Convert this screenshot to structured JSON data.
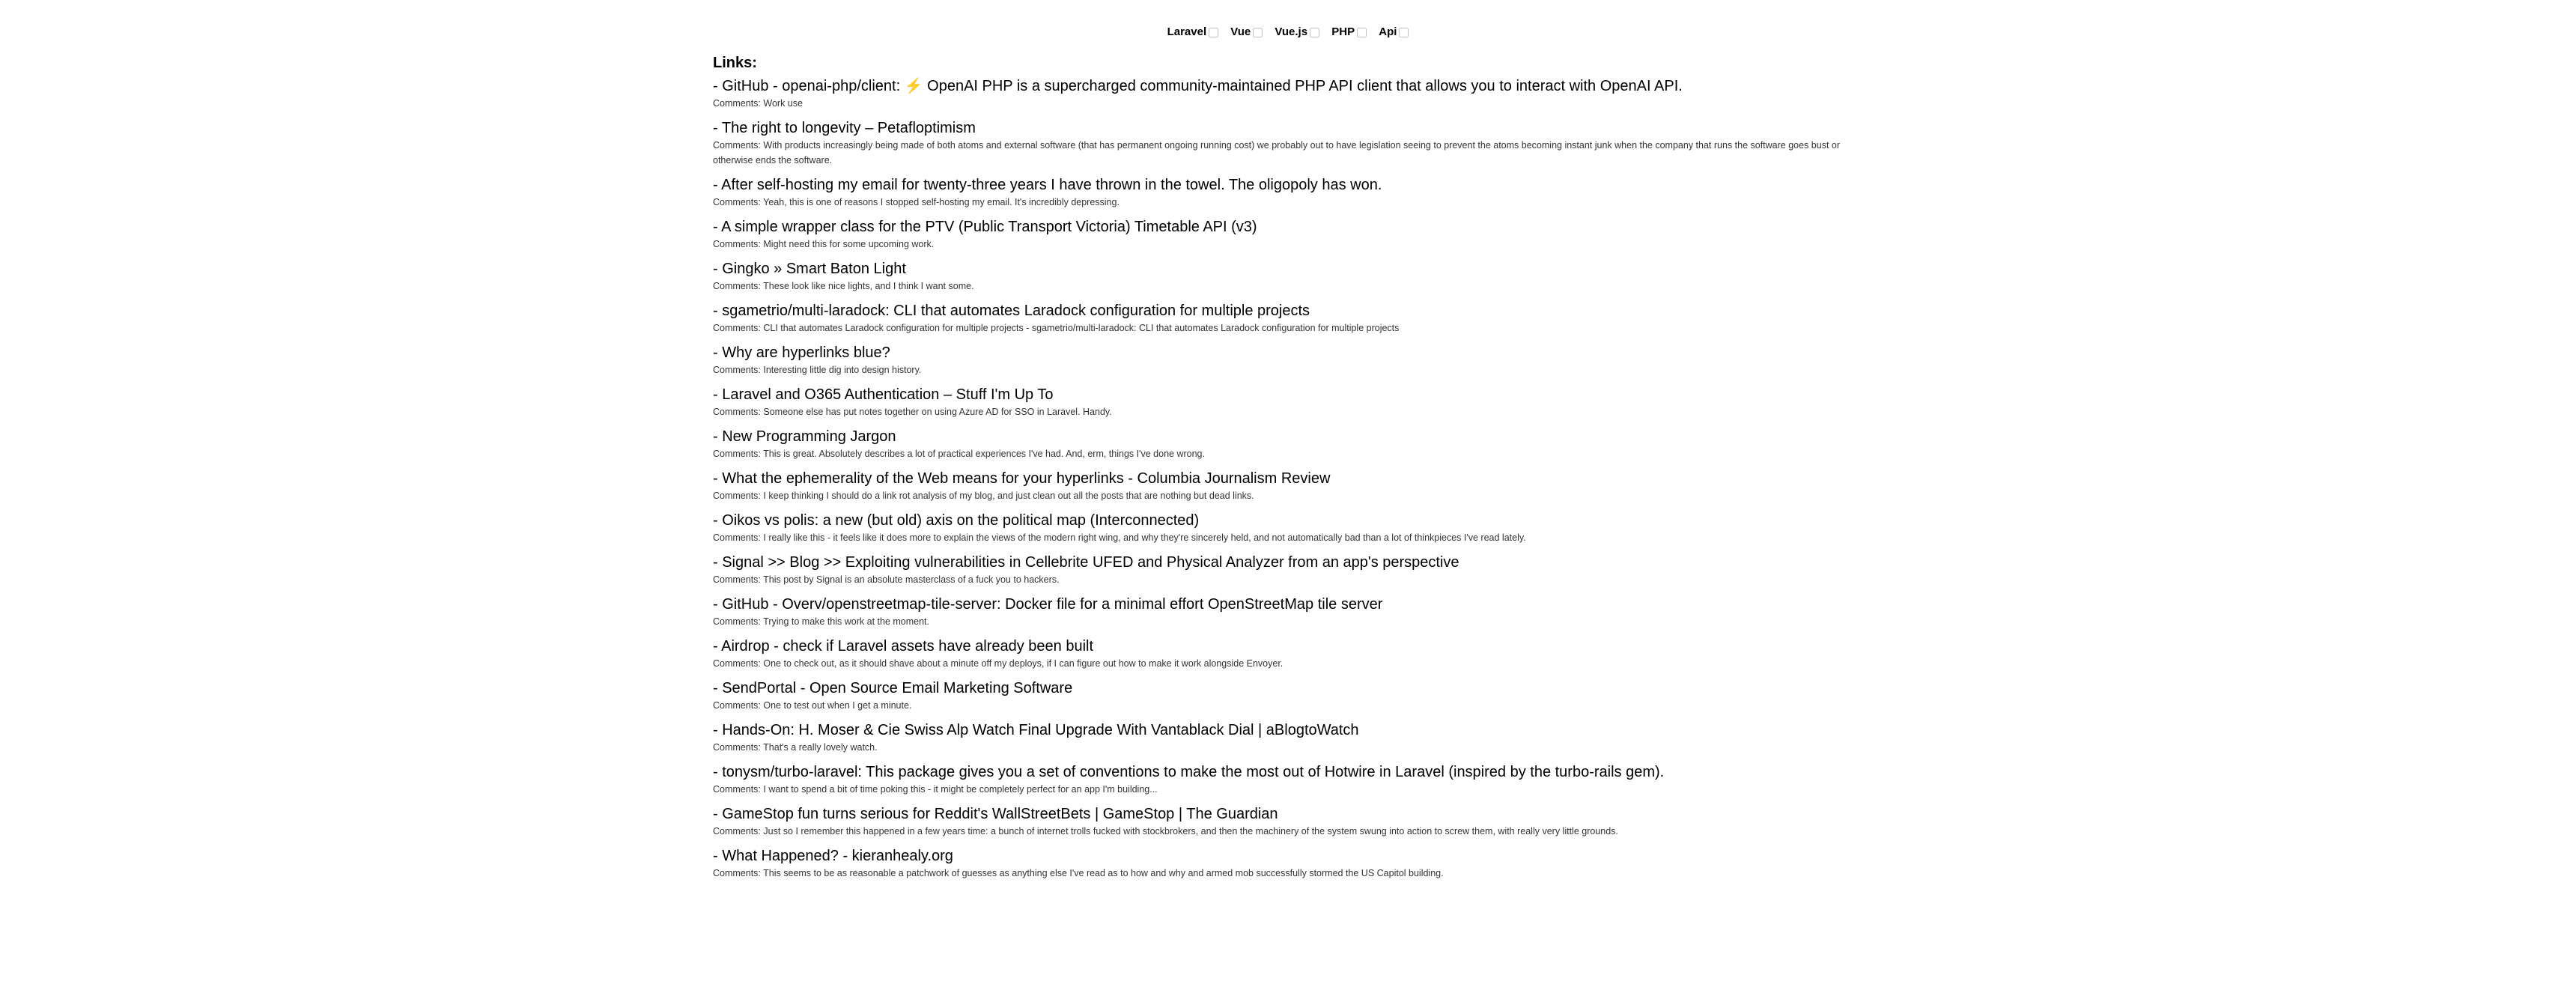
{
  "filters": [
    {
      "label": "Laravel",
      "checked": false
    },
    {
      "label": "Vue",
      "checked": false
    },
    {
      "label": "Vue.js",
      "checked": false
    },
    {
      "label": "PHP",
      "checked": false
    },
    {
      "label": "Api",
      "checked": false
    }
  ],
  "links_heading": "Links:",
  "links": [
    {
      "title": "- GitHub - openai-php/client: ⚡️ OpenAI PHP is a supercharged community-maintained PHP API client that allows you to interact with OpenAI API.",
      "comment": "Comments: Work use"
    },
    {
      "title": "- The right to longevity – Petafloptimism",
      "comment": "Comments: With products increasingly being made of both atoms and external software (that has permanent ongoing running cost) we probably out to have legislation seeing to prevent the atoms becoming instant junk when the company that runs the software goes bust or otherwise ends the software."
    },
    {
      "title": "- After self-hosting my email for twenty-three years I have thrown in the towel. The oligopoly has won.",
      "comment": "Comments: Yeah, this is one of reasons I stopped self-hosting my email. It's incredibly depressing."
    },
    {
      "title": "- A simple wrapper class for the PTV (Public Transport Victoria) Timetable API (v3)",
      "comment": "Comments: Might need this for some upcoming work."
    },
    {
      "title": "- Gingko » Smart Baton Light",
      "comment": "Comments: These look like nice lights, and I think I want some."
    },
    {
      "title": "- sgametrio/multi-laradock: CLI that automates Laradock configuration for multiple projects",
      "comment": "Comments: CLI that automates Laradock configuration for multiple projects - sgametrio/multi-laradock: CLI that automates Laradock configuration for multiple projects"
    },
    {
      "title": "- Why are hyperlinks blue?",
      "comment": "Comments: Interesting little dig into design history."
    },
    {
      "title": "- Laravel and O365 Authentication – Stuff I'm Up To",
      "comment": "Comments: Someone else has put notes together on using Azure AD for SSO in Laravel. Handy."
    },
    {
      "title": "- New Programming Jargon",
      "comment": "Comments: This is great. Absolutely describes a lot of practical experiences I've had. And, erm, things I've done wrong."
    },
    {
      "title": "- What the ephemerality of the Web means for your hyperlinks - Columbia Journalism Review",
      "comment": "Comments: I keep thinking I should do a link rot analysis of my blog, and just clean out all the posts that are nothing but dead links."
    },
    {
      "title": "- Oikos vs polis: a new (but old) axis on the political map (Interconnected)",
      "comment": "Comments: I really like this - it feels like it does more to explain the views of the modern right wing, and why they're sincerely held, and not automatically bad than a lot of thinkpieces I've read lately."
    },
    {
      "title": "- Signal >> Blog >> Exploiting vulnerabilities in Cellebrite UFED and Physical Analyzer from an app's perspective",
      "comment": "Comments: This post by Signal is an absolute masterclass of a fuck you to hackers."
    },
    {
      "title": "- GitHub - Overv/openstreetmap-tile-server: Docker file for a minimal effort OpenStreetMap tile server",
      "comment": "Comments: Trying to make this work at the moment."
    },
    {
      "title": "- Airdrop - check if Laravel assets have already been built",
      "comment": "Comments: One to check out, as it should shave about a minute off my deploys, if I can figure out how to make it work alongside Envoyer."
    },
    {
      "title": "- SendPortal - Open Source Email Marketing Software",
      "comment": "Comments: One to test out when I get a minute."
    },
    {
      "title": "- Hands-On: H. Moser & Cie Swiss Alp Watch Final Upgrade With Vantablack Dial | aBlogtoWatch",
      "comment": "Comments: That's a really lovely watch."
    },
    {
      "title": "- tonysm/turbo-laravel: This package gives you a set of conventions to make the most out of Hotwire in Laravel (inspired by the turbo-rails gem).",
      "comment": "Comments: I want to spend a bit of time poking this - it might be completely perfect for an app I'm building..."
    },
    {
      "title": "- GameStop fun turns serious for Reddit's WallStreetBets | GameStop | The Guardian",
      "comment": "Comments: Just so I remember this happened in a few years time: a bunch of internet trolls fucked with stockbrokers, and then the machinery of the system swung into action to screw them, with really very little grounds."
    },
    {
      "title": "- What Happened? - kieranhealy.org",
      "comment": "Comments: This seems to be as reasonable a patchwork of guesses as anything else I've read as to how and why and armed mob successfully stormed the US Capitol building."
    }
  ]
}
